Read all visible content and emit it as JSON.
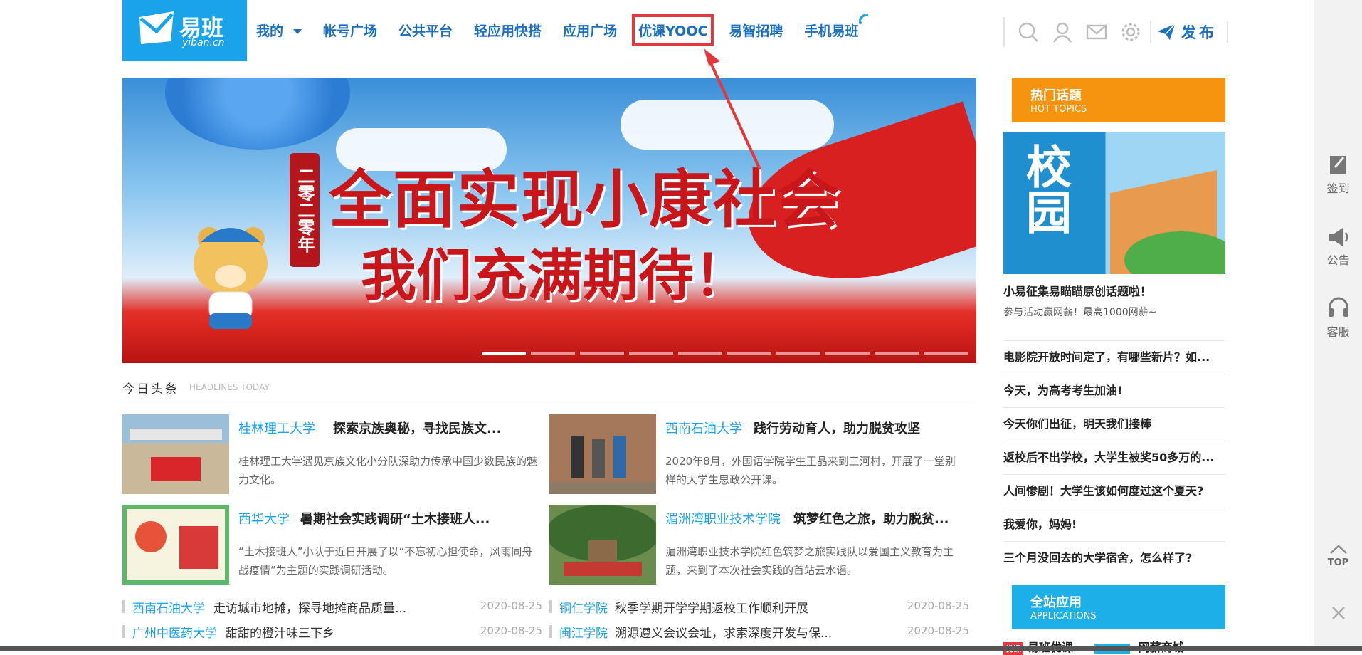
{
  "logo": {
    "name": "易班",
    "sub": "yiban.cn"
  },
  "nav": {
    "items": [
      "我的",
      "帐号广场",
      "公共平台",
      "轻应用快搭",
      "应用广场",
      "优课YOOC",
      "易智招聘",
      "手机易班"
    ]
  },
  "toolbar": {
    "publish": "发布",
    "icons": [
      "search-icon",
      "user-icon",
      "mail-icon",
      "gear-icon",
      "paper-plane-icon"
    ]
  },
  "banner": {
    "vertical": "二零二零年",
    "line1": "全面实现小康社会",
    "line2": "我们充满期待！",
    "slides": 10,
    "active": 0
  },
  "headlines": {
    "title": "今日头条",
    "subtitle": "HEADLINES TODAY",
    "cards": [
      {
        "uni": "桂林理工大学",
        "title": "探索京族奥秘，寻找民族文...",
        "desc": "桂林理工大学遇见京族文化小分队深助力传承中国少数民族的魅力文化。"
      },
      {
        "uni": "西南石油大学",
        "title": "践行劳动育人，助力脱贫攻坚",
        "desc": "2020年8月，外国语学院学生王晶来到三河村，开展了一堂别样的大学生思政公开课。"
      },
      {
        "uni": "西华大学",
        "title": "暑期社会实践调研“土木接班人...",
        "desc": "“土木接班人”小队于近日开展了以“不忘初心担使命，风雨同舟战疫情”为主题的实践调研活动。"
      },
      {
        "uni": "湄洲湾职业技术学院",
        "title": "筑梦红色之旅，助力脱贫...",
        "desc": "湄洲湾职业技术学院红色筑梦之旅实践队以爱国主义教育为主题，来到了本次社会实践的首站云水谣。"
      }
    ],
    "links": [
      {
        "uni": "西南石油大学",
        "title": "走访城市地摊，探寻地摊商品质量...",
        "date": "2020-08-25"
      },
      {
        "uni": "铜仁学院",
        "title": "秋季学期开学学期返校工作顺利开展",
        "date": "2020-08-25"
      },
      {
        "uni": "广州中医药大学",
        "title": "甜甜的橙汁味三下乡",
        "date": "2020-08-25"
      },
      {
        "uni": "闽江学院",
        "title": "溯源遵义会议会址，求索深度开发与保...",
        "date": "2020-08-25"
      }
    ]
  },
  "hot": {
    "title": "热门话题",
    "subtitle": "HOT TOPICS",
    "promo": {
      "calligraphy": "校园",
      "title": "小易征集易瞄瞄原创话题啦！",
      "sub": "参与活动赢网薪！最高1000网薪~"
    },
    "topics": [
      "电影院开放时间定了，有哪些新片？如...",
      "今天，为高考考生加油!",
      "今天你们出征，明天我们接棒",
      "返校后不出学校，大学生被奖50多万的...",
      "人间惨剧！大学生该如何度过这个夏天?",
      "我爱你，妈妈!",
      "三个月没回去的大学宿舍，怎么样了?"
    ]
  },
  "apps": {
    "title": "全站应用",
    "subtitle": "APPLICATIONS",
    "row": [
      "易班优课",
      "网薪商城"
    ]
  },
  "side": {
    "checkin": "签到",
    "notice": "公告",
    "service": "客服",
    "top": "TOP"
  }
}
